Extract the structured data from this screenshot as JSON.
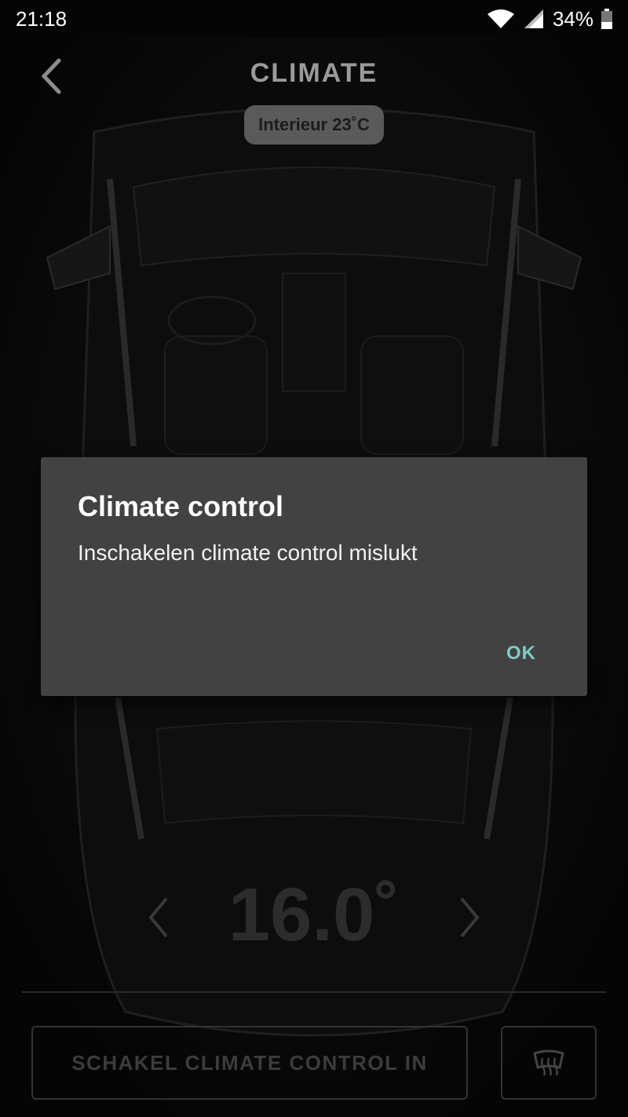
{
  "status_bar": {
    "time": "21:18",
    "battery": "34%",
    "icons": [
      "wifi-icon",
      "signal-icon",
      "battery-icon"
    ]
  },
  "header": {
    "back_icon": "chevron-left-icon",
    "title": "CLIMATE",
    "interior_temp": "Interieur 23˚C"
  },
  "temperature": {
    "value": "16.0˚",
    "prev_icon": "chevron-left-icon",
    "next_icon": "chevron-right-icon"
  },
  "actions": {
    "climate_button": "SCHAKEL CLIMATE CONTROL IN",
    "defrost_icon": "rear-defrost-icon"
  },
  "dialog": {
    "title": "Climate control",
    "message": "Inschakelen climate control mislukt",
    "ok_label": "OK"
  },
  "colors": {
    "background": "#050505",
    "dialog_bg": "#424242",
    "accent": "#80cbc4"
  }
}
